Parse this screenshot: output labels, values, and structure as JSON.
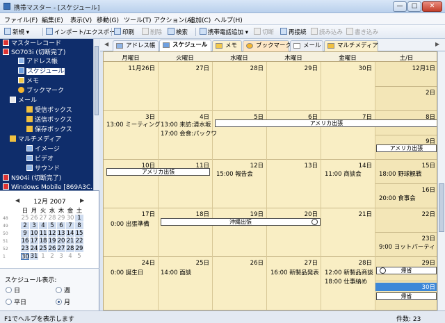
{
  "window": {
    "title": "携帯マスター - [スケジュール]",
    "min": "—",
    "max": "□",
    "close": "✕"
  },
  "menu": [
    "ファイル(F)",
    "編集(E)",
    "表示(V)",
    "移動(G)",
    "ツール(T)",
    "アクション(A)",
    "追加(C)",
    "ヘルプ(H)"
  ],
  "toolbar": {
    "new": "新規 ▾",
    "import_export": "インポート/エクスポート",
    "print": "印刷",
    "delete": "削除",
    "search": "検索",
    "add_phone": "携帯電話追加 ▾",
    "disconnect": "切断",
    "reconnect": "再接続",
    "read": "読み込み",
    "write": "書き込み"
  },
  "tree": {
    "items": [
      {
        "label": "マスターレコード"
      },
      {
        "label": "SO703i (切断完了)"
      },
      {
        "label": "アドレス帳"
      },
      {
        "label": "スケジュール"
      },
      {
        "label": "メモ"
      },
      {
        "label": "ブックマーク"
      },
      {
        "label": "メール"
      },
      {
        "label": "受信ボックス"
      },
      {
        "label": "送信ボックス"
      },
      {
        "label": "保存ボックス"
      },
      {
        "label": "マルチメディア"
      },
      {
        "label": "イメージ"
      },
      {
        "label": "ビデオ"
      },
      {
        "label": "サウンド"
      },
      {
        "label": "N904i (切断完了)"
      },
      {
        "label": "Windows Mobile [869A3C..."
      }
    ]
  },
  "minical": {
    "month": "12月 2007",
    "prev": "◀",
    "next": "▶",
    "dow": [
      "日",
      "月",
      "火",
      "水",
      "木",
      "金",
      "土"
    ],
    "weeks": [
      {
        "wk": "48",
        "days": [
          "25",
          "26",
          "27",
          "28",
          "29",
          "30",
          "1"
        ]
      },
      {
        "wk": "49",
        "days": [
          "2",
          "3",
          "4",
          "5",
          "6",
          "7",
          "8"
        ]
      },
      {
        "wk": "50",
        "days": [
          "9",
          "10",
          "11",
          "12",
          "13",
          "14",
          "15"
        ]
      },
      {
        "wk": "51",
        "days": [
          "16",
          "17",
          "18",
          "19",
          "20",
          "21",
          "22"
        ]
      },
      {
        "wk": "52",
        "days": [
          "23",
          "24",
          "25",
          "26",
          "27",
          "28",
          "29"
        ]
      },
      {
        "wk": "1",
        "days": [
          "30",
          "31",
          "1",
          "2",
          "3",
          "4",
          "5"
        ]
      }
    ]
  },
  "display": {
    "label": "スケジュール表示:",
    "day": "日",
    "week": "週",
    "weekday": "平日",
    "month": "月",
    "selected": "month"
  },
  "tabs": {
    "address": "アドレス帳",
    "schedule": "スケジュール",
    "memo": "メモ",
    "bookmark": "ブックマーク",
    "mail": "メール",
    "multimedia": "マルチメディア",
    "left_arrow": "◀",
    "right_arrow": "▶"
  },
  "calendar": {
    "headers": [
      "月曜日",
      "火曜日",
      "水曜日",
      "木曜日",
      "金曜日",
      "土/日"
    ],
    "weeks": [
      {
        "days": [
          "11月26日",
          "27日",
          "28日",
          "29日",
          "30日",
          "12月1日"
        ],
        "sun": "2日"
      },
      {
        "days": [
          "3日",
          "4日",
          "5日",
          "6日",
          "7日",
          "8日"
        ],
        "sun": "9日"
      },
      {
        "days": [
          "10日",
          "11日",
          "12日",
          "13日",
          "14日",
          "15日"
        ],
        "sun": "16日"
      },
      {
        "days": [
          "17日",
          "18日",
          "19日",
          "20日",
          "21日",
          "22日"
        ],
        "sun": "23日"
      },
      {
        "days": [
          "24日",
          "25日",
          "26日",
          "27日",
          "28日",
          "29日"
        ],
        "sun": "30日"
      }
    ],
    "events": {
      "w2_mon": "13:00 ミーティング",
      "w2_tue_1": "13:00 来訪:清水坂",
      "w2_tue_2": "17:00 会食:パックワ",
      "w2_bar": "アメリカ出張",
      "w2_sun_bar": "アメリカ出張",
      "w3_bar": "アメリカ出張",
      "w3_wed": "15:00 報告会",
      "w3_fri": "11:00 商談会",
      "w3_sat": "18:00 野球観戦",
      "w3_sun": "20:00 食事会",
      "w4_mon": "0:00 出張準備",
      "w4_bar": "沖縄出張",
      "w4_sun": "9:00 ヨットパーティ",
      "w5_mon": "0:00 誕生日",
      "w5_tue": "14:00 面談",
      "w5_thu": "16:00 新製品発表",
      "w5_fri_1": "12:00 新製品商談",
      "w5_fri_2": "18:00 仕事納め",
      "w5_sat_bar": "帰省",
      "w5_sun_bar": "帰省"
    }
  },
  "status": {
    "help": "F1でヘルプを表示します",
    "count": "件数: 23"
  }
}
